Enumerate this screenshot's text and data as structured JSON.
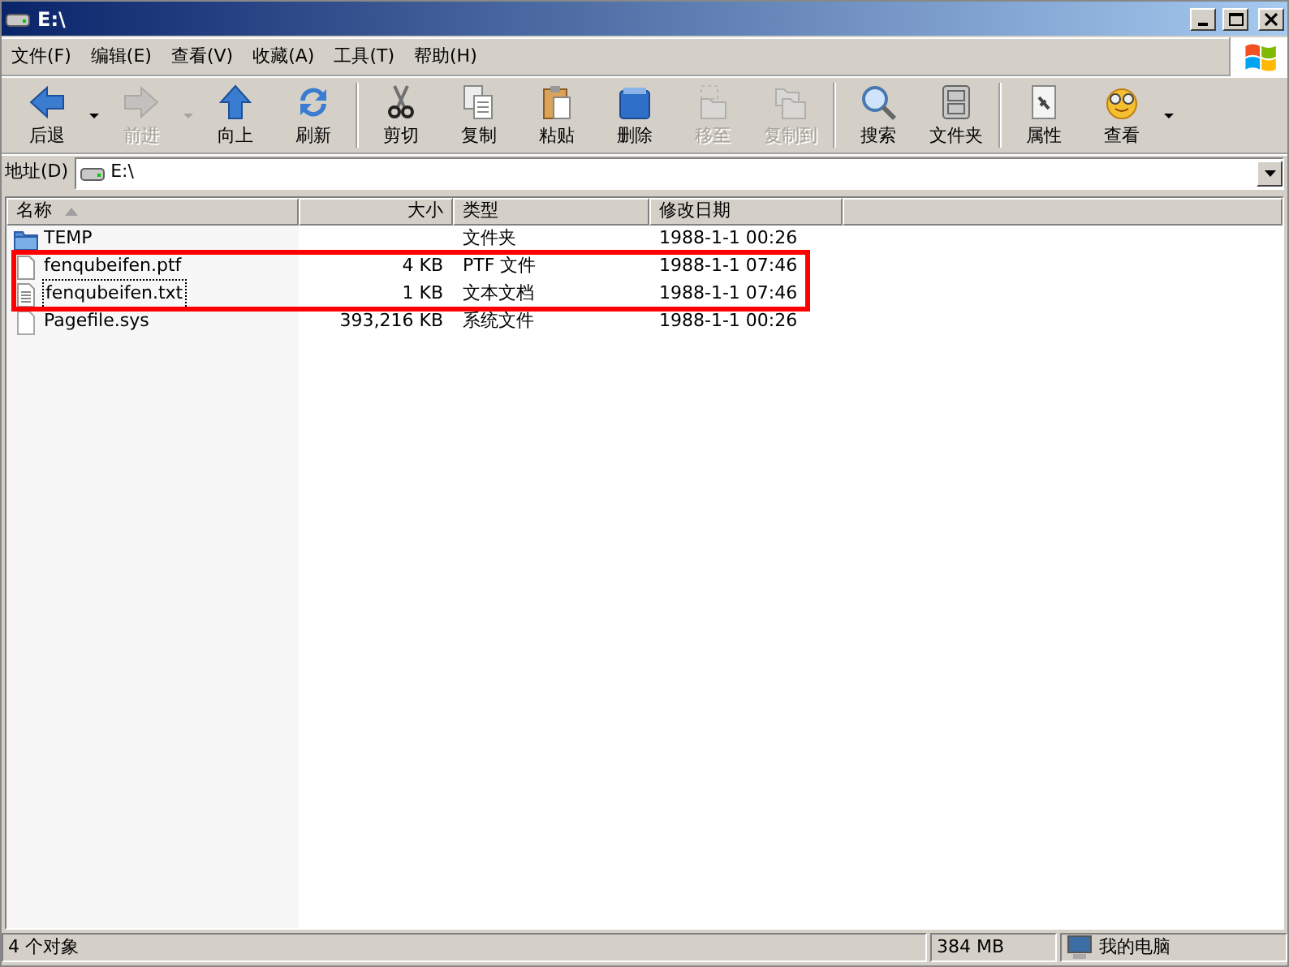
{
  "window": {
    "title": "E:\\"
  },
  "menu": [
    "文件(F)",
    "编辑(E)",
    "查看(V)",
    "收藏(A)",
    "工具(T)",
    "帮助(H)"
  ],
  "toolbar": {
    "groups": [
      [
        {
          "label": "后退",
          "disabled": false,
          "dropdown": true
        },
        {
          "label": "前进",
          "disabled": true,
          "dropdown": true
        },
        {
          "label": "向上",
          "disabled": false,
          "dropdown": false
        },
        {
          "label": "刷新",
          "disabled": false,
          "dropdown": false
        }
      ],
      [
        {
          "label": "剪切",
          "disabled": false,
          "dropdown": false
        },
        {
          "label": "复制",
          "disabled": false,
          "dropdown": false
        },
        {
          "label": "粘贴",
          "disabled": false,
          "dropdown": false
        },
        {
          "label": "删除",
          "disabled": false,
          "dropdown": false
        },
        {
          "label": "移至",
          "disabled": true,
          "dropdown": false
        },
        {
          "label": "复制到",
          "disabled": true,
          "dropdown": false
        }
      ],
      [
        {
          "label": "搜索",
          "disabled": false,
          "dropdown": false
        },
        {
          "label": "文件夹",
          "disabled": false,
          "dropdown": false
        }
      ],
      [
        {
          "label": "属性",
          "disabled": false,
          "dropdown": false
        },
        {
          "label": "查看",
          "disabled": false,
          "dropdown": true
        }
      ]
    ]
  },
  "address": {
    "label": "地址(D)",
    "value": "E:\\"
  },
  "table": {
    "columns": [
      {
        "label": "名称",
        "sorted": true
      },
      {
        "label": "大小",
        "sorted": false
      },
      {
        "label": "类型",
        "sorted": false
      },
      {
        "label": "修改日期",
        "sorted": false
      }
    ],
    "rows": [
      {
        "kind": "folder",
        "name": "TEMP",
        "size": "",
        "type": "文件夹",
        "date": "1988-1-1 00:26",
        "highlighted": false,
        "focused": false
      },
      {
        "kind": "file",
        "name": "fenqubeifen.ptf",
        "size": "4 KB",
        "type": "PTF 文件",
        "date": "1988-1-1 07:46",
        "highlighted": true,
        "focused": false
      },
      {
        "kind": "text",
        "name": "fenqubeifen.txt",
        "size": "1 KB",
        "type": "文本文档",
        "date": "1988-1-1 07:46",
        "highlighted": true,
        "focused": true
      },
      {
        "kind": "system",
        "name": "Pagefile.sys",
        "size": "393,216 KB",
        "type": "系统文件",
        "date": "1988-1-1 00:26",
        "highlighted": false,
        "focused": false
      }
    ]
  },
  "status_bar": {
    "objects": "4 个对象",
    "size": "384 MB",
    "zone": "我的电脑"
  }
}
